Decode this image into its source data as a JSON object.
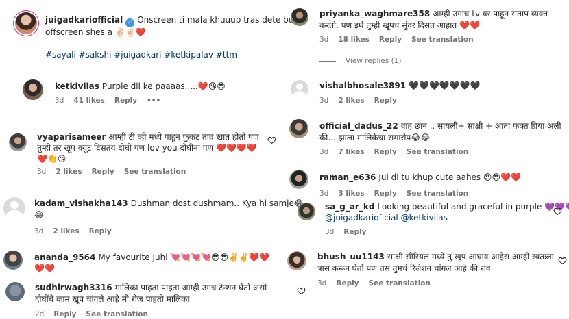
{
  "left": {
    "c1": {
      "user": "juigadkariofficial",
      "verified_glyph": "✓",
      "text_l1": "Onscreen ti mala khuuup tras dete but",
      "text_l2": "offscreen shes a ✌🏻✌🏻❤️",
      "tags": "#sayali #sakshi #juigadkari #ketkipalav #ttm"
    },
    "c2": {
      "user": "ketkivilas",
      "text": "Purple dil ke paaaas.....❤️😘😍",
      "time": "3d",
      "likes": "41 likes",
      "reply": "Reply",
      "more": "•••"
    },
    "c3": {
      "user": "vyaparisameer",
      "text_l1": "आम्ही टी व्ही मध्ये पाहून फुकट ताव खात होतो पण",
      "text_l2": "तुम्ही तर खूप क्यूट दिसतंय दोघी पण lov you दोघींना पण ❤️❤️❤️❤️",
      "text_l3": "❤️👏😘",
      "time": "3d",
      "likes": "2 likes",
      "reply": "Reply",
      "translate": "See translation"
    },
    "c4": {
      "user": "kadam_vishakha143",
      "text": "Dushman dost dushmam.. Kya hi samje😂",
      "text_l2": "😂",
      "time": "3d",
      "likes": "2 likes",
      "reply": "Reply"
    },
    "c5": {
      "user": "ananda_9564",
      "text": "My favourite Juhi 💘💘💘💘😎😎✌️✌️❤️❤️",
      "text_l2": "❤️❤️"
    },
    "c6": {
      "user": "sudhirwagh3316",
      "text_l1": "मालिका पाहता पाहता आम्ही उगच टेन्शन घेतो असो",
      "text_l2": "दोघींचे काम खूप चांगले आहे मी रोज पाहतो मालिका",
      "time": "2d",
      "reply": "Reply",
      "translate": "See translation"
    }
  },
  "right": {
    "r1": {
      "user": "priyanka_waghmare358",
      "text_l1": "आम्ही उगाच tv वर पाहून संताप व्यक्त",
      "text_l2": "करतो. पण इथे तुम्ही खूपच सुंदर दिसत आहात ❤️❤️",
      "time": "3d",
      "likes": "18 likes",
      "reply": "Reply",
      "translate": "See translation",
      "view_replies": "View replies (1)"
    },
    "r2": {
      "user": "vishalbhosale3891",
      "text": "🖤🖤🖤🖤🖤🖤🖤",
      "time": "3d",
      "likes": "2 likes",
      "reply": "Reply"
    },
    "r3": {
      "user": "official_dadus_22",
      "text_l1": "वाह छान .. सायली+ साक्षी + आता फक्त प्रिया अली",
      "text_l2": "की... झाला मालिकेचा समारोप😂😂",
      "time": "3d",
      "likes": "7 likes",
      "reply": "Reply",
      "translate": "See translation"
    },
    "r4": {
      "user": "raman_e636",
      "text": "Jui di tu khup cute aahes 😍😍❤️❤️",
      "time": "3d",
      "likes": "3 likes",
      "reply": "Reply",
      "translate": "See translation"
    },
    "r5": {
      "user": "sa_g_ar_kd",
      "text": "Looking beautiful and graceful in purple 💜💜💜",
      "mention1": "@juigadkarioficial",
      "mention2": "@ketkivilas",
      "time": "3d",
      "reply": "Reply"
    },
    "r6": {
      "user": "bhush_uu1143",
      "text_l1": "साक्षी सीरियल मध्ये तु खूप आघाव आहेस आम्ही स्वतःला",
      "text_l2": "त्रास करून घेतो पण तस तुमचं रिलेशन चांगल आहे की राव",
      "time": "3d",
      "reply": "Reply",
      "translate": "See translation"
    }
  },
  "icons": {
    "heart": "heart-outline-icon",
    "more": "more-options-icon"
  },
  "colors": {
    "text": "#262626",
    "meta": "#737373",
    "link": "#00376b",
    "verified": "#3897f0"
  }
}
